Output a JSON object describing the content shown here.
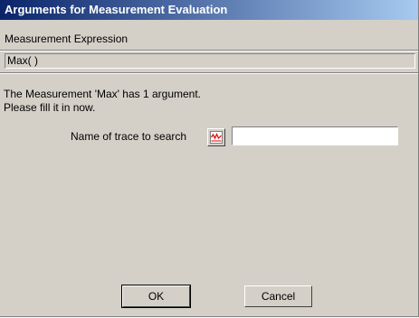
{
  "window": {
    "title": "Arguments for Measurement Evaluation"
  },
  "expression": {
    "label": "Measurement Expression",
    "value": "Max( )"
  },
  "message": {
    "line1": "The Measurement 'Max' has 1 argument.",
    "line2": "Please fill it in now."
  },
  "argument": {
    "label": "Name of trace to search",
    "value": "",
    "button_icon": "trace-waveform-icon"
  },
  "buttons": {
    "ok": "OK",
    "cancel": "Cancel"
  },
  "colors": {
    "title_start": "#0a246a",
    "title_end": "#a6caf0",
    "face": "#d4d0c8",
    "icon_trace": "#e00000"
  }
}
